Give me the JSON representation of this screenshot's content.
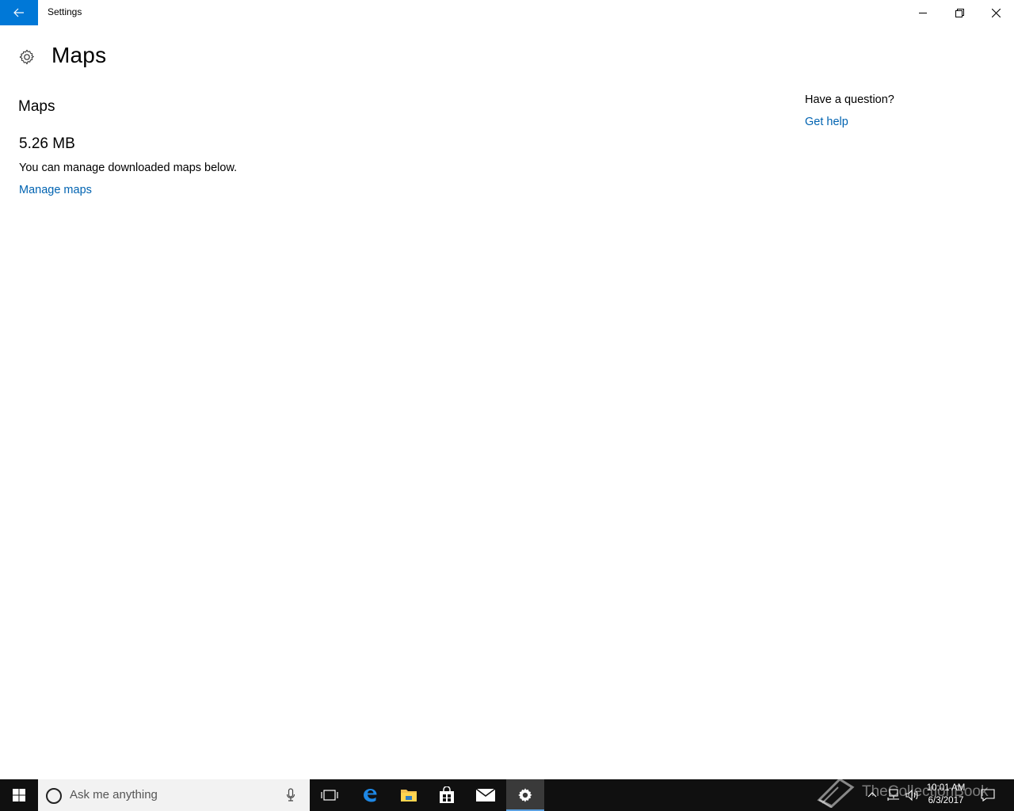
{
  "window": {
    "title": "Settings",
    "accent": "#0078d7"
  },
  "page": {
    "title": "Maps",
    "icon": "gear-icon"
  },
  "main": {
    "section_title": "Maps",
    "size": "5.26 MB",
    "description": "You can manage downloaded maps below.",
    "manage_link": "Manage maps"
  },
  "help": {
    "question": "Have a question?",
    "link": "Get help"
  },
  "taskbar": {
    "search_placeholder": "Ask me anything",
    "time": "10:01 AM",
    "date": "6/3/2017",
    "apps": [
      "task-view",
      "edge",
      "file-explorer",
      "store",
      "mail",
      "settings"
    ]
  },
  "watermark": "TheCollectionBook",
  "colors": {
    "link": "#0063b1",
    "taskbar": "#101010"
  }
}
